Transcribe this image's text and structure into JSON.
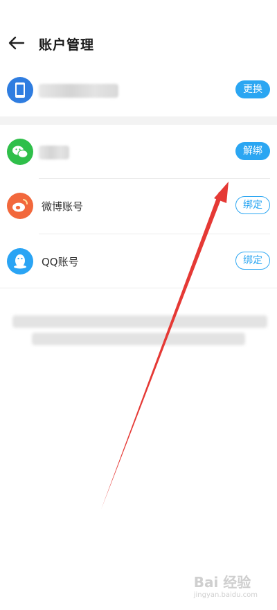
{
  "header": {
    "title": "账户管理"
  },
  "accounts": [
    {
      "icon": "phone-icon",
      "name_visible": false,
      "action": "更换",
      "action_style": "filled",
      "color": "#2f7de0"
    },
    {
      "icon": "wechat-icon",
      "name_visible": false,
      "action": "解绑",
      "action_style": "filled",
      "color": "#2fbf4a"
    },
    {
      "icon": "weibo-icon",
      "name": "微博账号",
      "action": "绑定",
      "action_style": "outline",
      "color": "#f2683c"
    },
    {
      "icon": "qq-icon",
      "name": "QQ账号",
      "action": "绑定",
      "action_style": "outline",
      "color": "#2aa4f4"
    }
  ],
  "colors": {
    "accent": "#2ba6f2",
    "annotation_arrow": "#e53935"
  },
  "watermark": {
    "text": "Bai 经验",
    "subtext": "jingyan.baidu.com"
  }
}
